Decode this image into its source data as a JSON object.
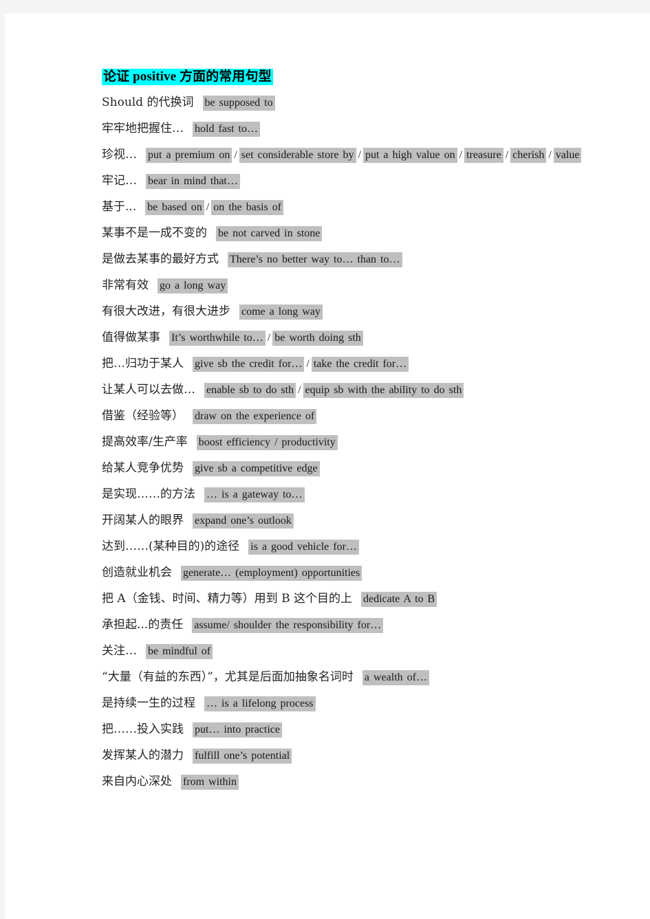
{
  "document": {
    "title_zh_prefix": "论证 ",
    "title_en": "positive",
    "title_zh_suffix": " 方面的常用句型",
    "title_highlight_color": "#00ffff",
    "phrase_highlight_color": "#bfbfbf",
    "page_background": "#ffffff",
    "canvas_background": "#f4f4f4"
  },
  "entries": [
    {
      "zh": "Should 的代换词",
      "phrases": [
        "be supposed to"
      ]
    },
    {
      "zh": "牢牢地把握住…",
      "phrases": [
        "hold fast to…"
      ]
    },
    {
      "zh": "珍视…",
      "phrases": [
        "put a premium on",
        "set considerable store by",
        "put a high value on",
        "treasure",
        "cherish",
        "value"
      ]
    },
    {
      "zh": "牢记…",
      "phrases": [
        "bear in mind that…"
      ]
    },
    {
      "zh": "基于...",
      "phrases": [
        "be based on",
        "on the basis of"
      ]
    },
    {
      "zh": "某事不是一成不变的",
      "phrases": [
        "be not carved in stone"
      ]
    },
    {
      "zh": "是做去某事的最好方式",
      "phrases": [
        "There’s no better way to… than to…"
      ]
    },
    {
      "zh": "非常有效",
      "phrases": [
        "go a long way"
      ]
    },
    {
      "zh": "有很大改进，有很大进步",
      "phrases": [
        "come a long way"
      ]
    },
    {
      "zh": "值得做某事",
      "phrases": [
        "It’s worthwhile to…",
        "be worth doing sth"
      ]
    },
    {
      "zh": "把…归功于某人",
      "phrases": [
        "give sb the credit for…",
        "take the credit for…"
      ]
    },
    {
      "zh": "让某人可以去做…",
      "phrases": [
        "enable sb to do sth",
        "equip sb with the ability to do sth"
      ]
    },
    {
      "zh": "借鉴（经验等）",
      "phrases": [
        "draw on the experience of"
      ]
    },
    {
      "zh": "提高效率/生产率",
      "phrases": [
        "boost efficiency / productivity"
      ]
    },
    {
      "zh": "给某人竞争优势",
      "phrases": [
        "give sb a competitive edge"
      ]
    },
    {
      "zh": "是实现……的方法",
      "phrases": [
        "… is a gateway to…"
      ]
    },
    {
      "zh": "开阔某人的眼界",
      "phrases": [
        "expand one’s outlook"
      ]
    },
    {
      "zh": "达到……(某种目的)的途径",
      "phrases": [
        "is a good vehicle for…"
      ]
    },
    {
      "zh": "创造就业机会",
      "phrases": [
        "generate… (employment) opportunities"
      ]
    },
    {
      "zh": "把 A（金钱、时间、精力等）用到 B 这个目的上",
      "phrases": [
        "dedicate A to B"
      ]
    },
    {
      "zh": "承担起...的责任",
      "phrases": [
        "assume/ shoulder the responsibility for…"
      ]
    },
    {
      "zh": "关注…",
      "phrases": [
        "be mindful of"
      ]
    },
    {
      "zh": "“大量（有益的东西）”，尤其是后面加抽象名词时",
      "phrases": [
        "a wealth of…"
      ]
    },
    {
      "zh": "是持续一生的过程",
      "phrases": [
        "… is a lifelong process"
      ]
    },
    {
      "zh": "把……投入实践",
      "phrases": [
        "put… into practice"
      ]
    },
    {
      "zh": "发挥某人的潜力",
      "phrases": [
        "fulfill one’s potential"
      ]
    },
    {
      "zh": "来自内心深处",
      "phrases": [
        "from within"
      ]
    }
  ],
  "separator": "/"
}
